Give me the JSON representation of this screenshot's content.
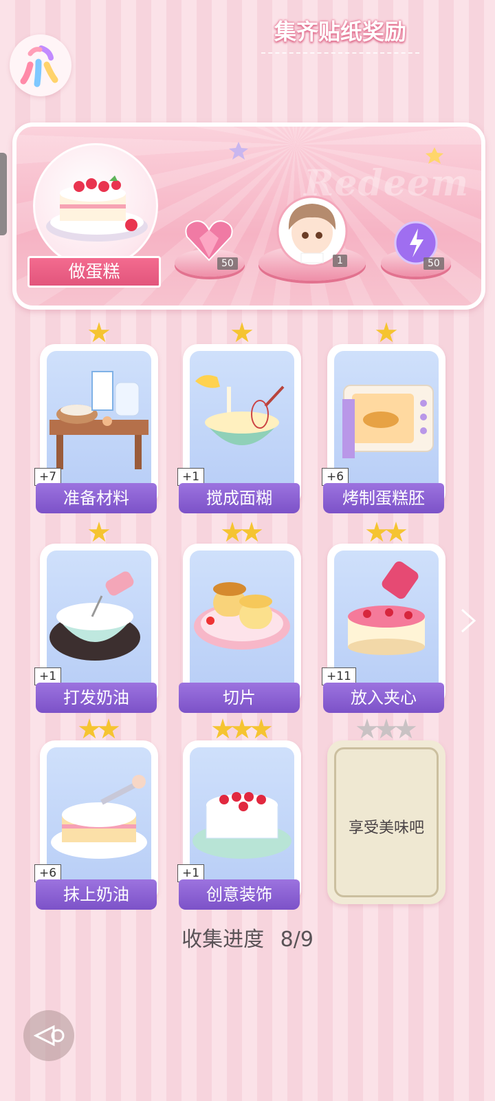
{
  "banner": {
    "title": "集齐贴纸奖励",
    "watermark": "Redeem",
    "cake_name": "做蛋糕",
    "rewards": [
      {
        "icon": "pink-heart-gem-icon",
        "count": "50"
      },
      {
        "icon": "chibi-boy-avatar-icon",
        "count": "1"
      },
      {
        "icon": "purple-lightning-orb-icon",
        "count": "50"
      }
    ]
  },
  "steps": [
    {
      "label": "准备材料",
      "bonus": "+7",
      "stars": 1,
      "icon": "ingredients-table-icon"
    },
    {
      "label": "搅成面糊",
      "bonus": "+1",
      "stars": 1,
      "icon": "mixing-bowl-icon"
    },
    {
      "label": "烤制蛋糕胚",
      "bonus": "+6",
      "stars": 1,
      "icon": "oven-icon"
    },
    {
      "label": "打发奶油",
      "bonus": "+1",
      "stars": 1,
      "icon": "whipping-cream-icon"
    },
    {
      "label": "切片",
      "bonus": "",
      "stars": 2,
      "icon": "sponge-slices-icon"
    },
    {
      "label": "放入夹心",
      "bonus": "+11",
      "stars": 2,
      "icon": "jam-filling-icon"
    },
    {
      "label": "抹上奶油",
      "bonus": "+6",
      "stars": 2,
      "icon": "spread-cream-icon"
    },
    {
      "label": "创意装饰",
      "bonus": "+1",
      "stars": 3,
      "icon": "decorated-cake-icon"
    }
  ],
  "locked_step": {
    "label": "享受美味吧",
    "stars": 3
  },
  "progress": {
    "label": "收集进度",
    "value": "8/9"
  },
  "colors": {
    "accent_purple": "#8a5fd6",
    "accent_pink": "#ec6087",
    "star_gold": "#f5c431"
  }
}
